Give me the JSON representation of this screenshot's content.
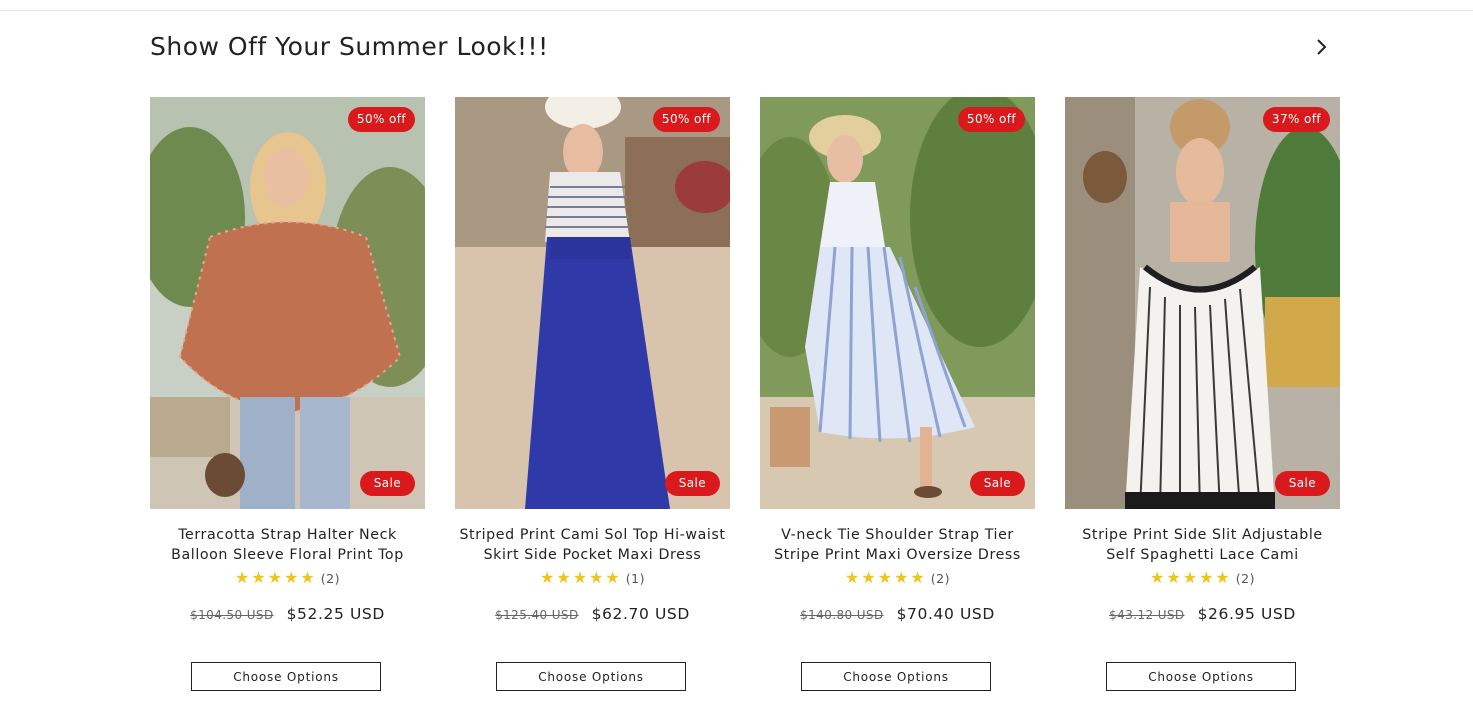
{
  "section": {
    "title": "Show Off Your Summer Look!!!",
    "next_icon": "chevron-right-icon"
  },
  "products": [
    {
      "discount_badge": "50% off",
      "sale_badge": "Sale",
      "title_line1": "Terracotta Strap Halter Neck",
      "title_line2": "Balloon Sleeve Floral Print Top",
      "rating_stars": 5,
      "stars": "★★★★★",
      "review_count": "(2)",
      "compare_price": "$104.50 USD",
      "price": "$52.25 USD",
      "button_label": "Choose Options"
    },
    {
      "discount_badge": "50% off",
      "sale_badge": "Sale",
      "title_line1": "Striped Print Cami Sol Top Hi-waist",
      "title_line2": "Skirt Side Pocket Maxi Dress",
      "rating_stars": 5,
      "stars": "★★★★★",
      "review_count": "(1)",
      "compare_price": "$125.40 USD",
      "price": "$62.70 USD",
      "button_label": "Choose Options"
    },
    {
      "discount_badge": "50% off",
      "sale_badge": "Sale",
      "title_line1": "V-neck Tie Shoulder Strap Tier",
      "title_line2": "Stripe Print Maxi Oversize Dress",
      "rating_stars": 5,
      "stars": "★★★★★",
      "review_count": "(2)",
      "compare_price": "$140.80 USD",
      "price": "$70.40 USD",
      "button_label": "Choose Options"
    },
    {
      "discount_badge": "37% off",
      "sale_badge": "Sale",
      "title_line1": "Stripe Print Side Slit Adjustable",
      "title_line2": "Self Spaghetti Lace Cami",
      "rating_stars": 5,
      "stars": "★★★★★",
      "review_count": "(2)",
      "compare_price": "$43.12 USD",
      "price": "$26.95 USD",
      "button_label": "Choose Options"
    }
  ],
  "colors": {
    "badge": "#d9191c",
    "star": "#f0c419",
    "text": "#222222"
  }
}
